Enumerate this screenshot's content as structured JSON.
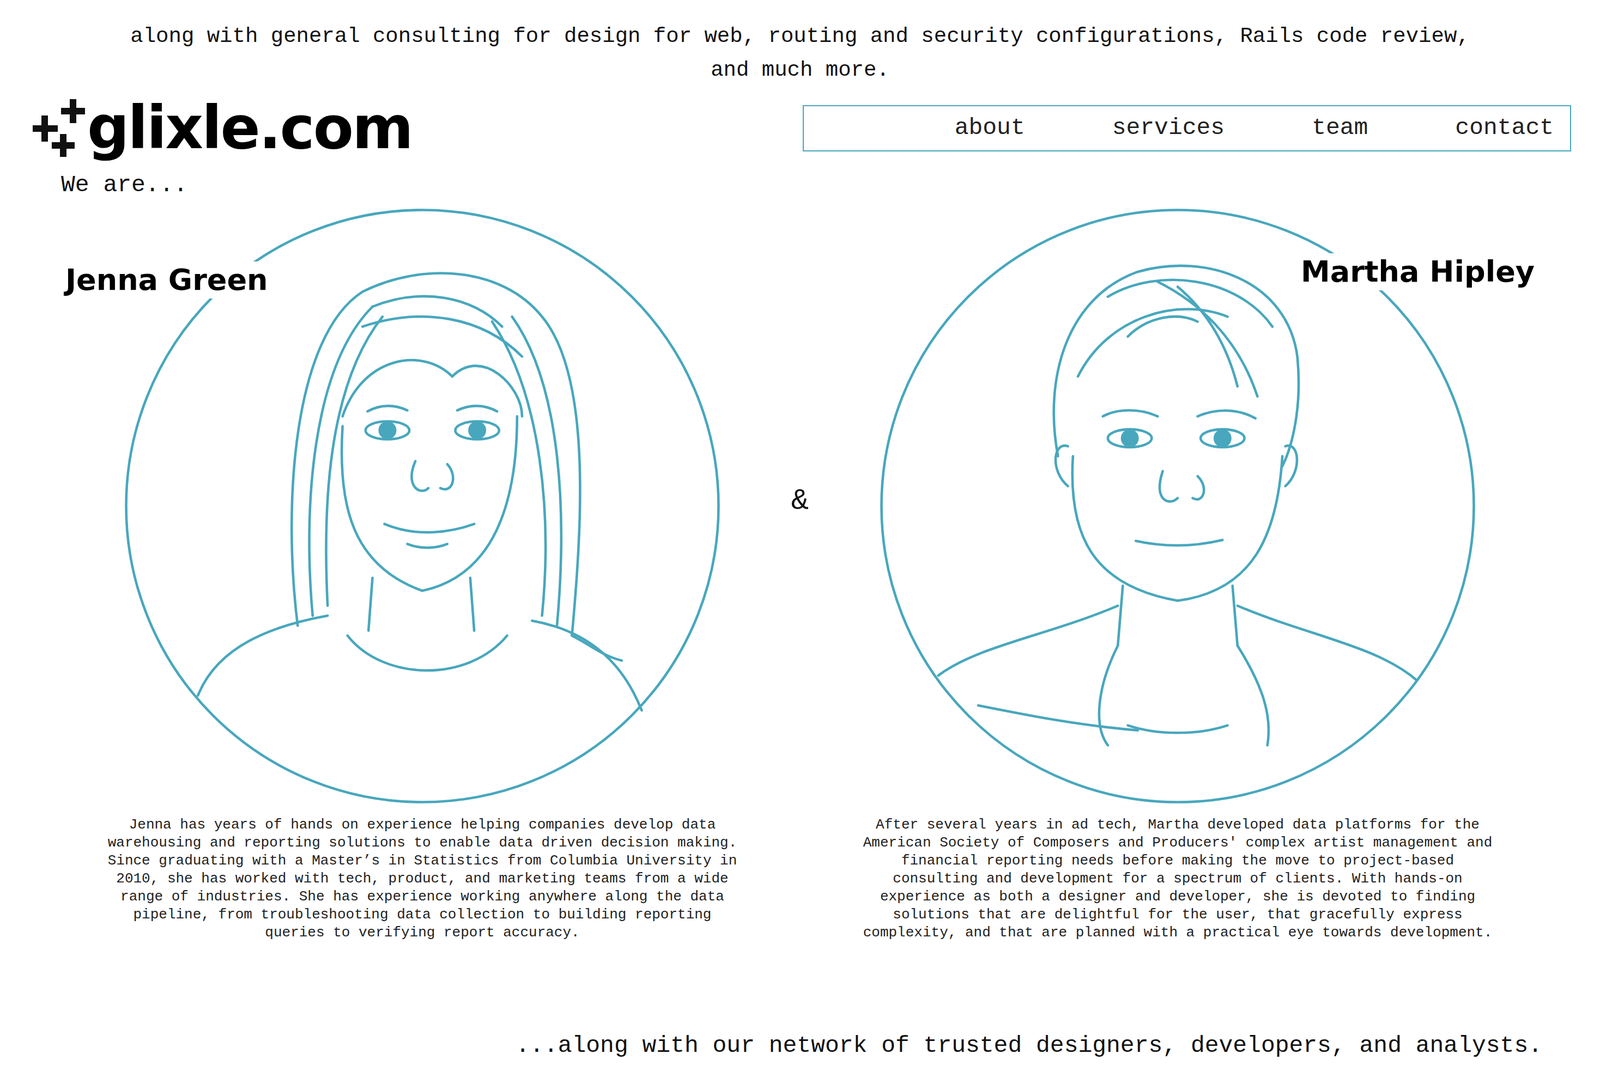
{
  "top_text": "along with general consulting for design for web, routing and security configurations, Rails code review, and much more.",
  "logo": {
    "text": "glixle.com"
  },
  "nav": {
    "items": [
      {
        "label": "about"
      },
      {
        "label": "services"
      },
      {
        "label": "team"
      },
      {
        "label": "contact"
      }
    ]
  },
  "intro": "We are...",
  "separator": "&",
  "members": [
    {
      "name": "Jenna Green",
      "bio": "Jenna has years of hands on experience helping companies develop data warehousing and reporting solutions to enable data driven decision making. Since graduating with a Master’s in Statistics from Columbia University in 2010, she has worked with tech, product, and marketing teams from a wide range of industries. She has experience working anywhere along the data pipeline, from troubleshooting data collection to building reporting queries to verifying report accuracy."
    },
    {
      "name": "Martha Hipley",
      "bio": "After several years in ad tech, Martha developed data platforms for the American Society of Composers and Producers' complex artist management and financial reporting needs before making the move to project-based consulting and development for a spectrum of clients. With hands-on experience as both a designer and developer, she is devoted to finding solutions that are delightful for the user, that gracefully express complexity, and that are planned with a practical eye towards development."
    }
  ],
  "footer": "...along with our network of trusted designers, developers, and analysts."
}
